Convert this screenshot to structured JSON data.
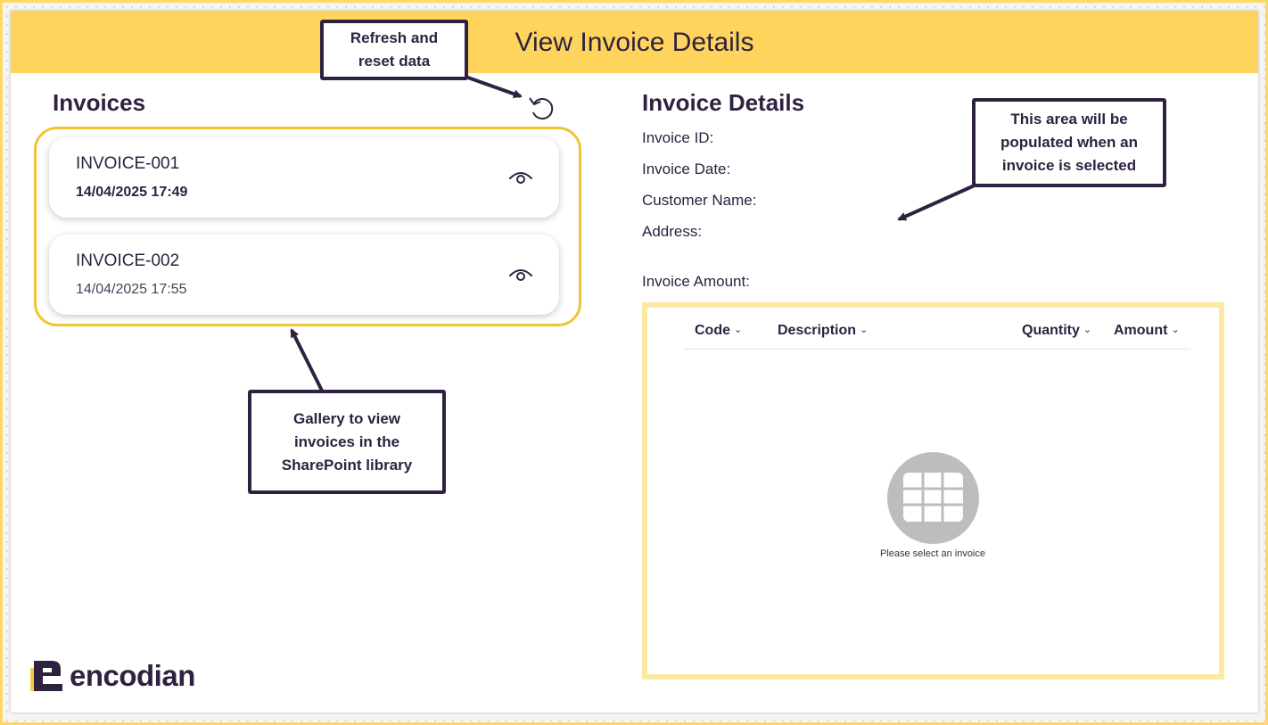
{
  "header": {
    "title": "View Invoice Details"
  },
  "gallery": {
    "title": "Invoices",
    "items": [
      {
        "name": "INVOICE-001",
        "date": "14/04/2025 17:49"
      },
      {
        "name": "INVOICE-002",
        "date": "14/04/2025 17:55"
      }
    ]
  },
  "details": {
    "title": "Invoice Details",
    "fields": {
      "invoice_id": "Invoice ID:",
      "invoice_date": "Invoice Date:",
      "customer_name": "Customer Name:",
      "address": "Address:",
      "invoice_amount": "Invoice Amount:"
    },
    "table": {
      "columns": [
        "Code",
        "Description",
        "Quantity",
        "Amount"
      ],
      "empty_message": "Please select an invoice"
    }
  },
  "callouts": {
    "refresh": [
      "Refresh and",
      "reset data"
    ],
    "populated": [
      "This area will be",
      "populated when an",
      "invoice is selected"
    ],
    "gallery": [
      "Gallery to view",
      "invoices in the",
      "SharePoint library"
    ]
  },
  "logo": {
    "text": "encodian"
  },
  "icons": {
    "refresh": "refresh-icon",
    "view": "eye-icon",
    "empty": "table-grid-icon",
    "logo": "encodian-logo-icon"
  },
  "colors": {
    "header": "#ffd45c",
    "accent_border": "#f0c534",
    "table_border": "#fce9a3",
    "text_dark": "#2e2240"
  }
}
